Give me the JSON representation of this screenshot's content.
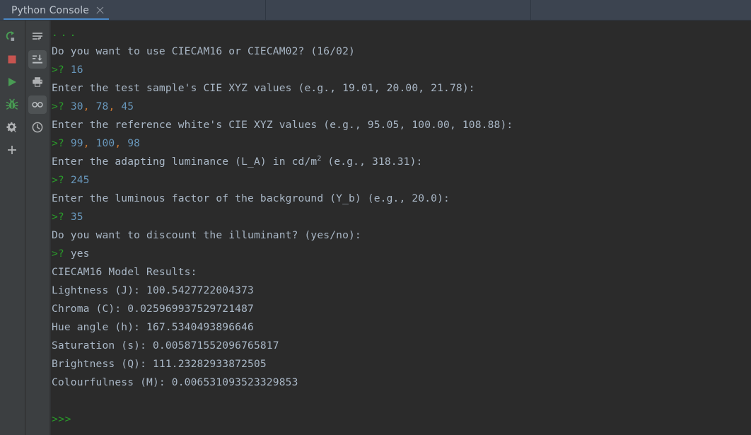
{
  "window": {
    "tab": {
      "label": "Python Console",
      "close_icon": "close-icon"
    },
    "background": "#2b2b2b",
    "header_background": "#3c4450",
    "accent": "#4a88c7"
  },
  "toolbar_left": {
    "buttons": [
      {
        "name": "rerun-button",
        "icon": "rerun-icon",
        "color": "#499c54",
        "active": false
      },
      {
        "name": "stop-button",
        "icon": "stop-square-icon",
        "color": "#c75450",
        "active": false
      },
      {
        "name": "execute-button",
        "icon": "play-triangle-icon",
        "color": "#499c54",
        "active": false
      },
      {
        "name": "debug-button",
        "icon": "bug-icon",
        "color": "#499c54",
        "active": false
      },
      {
        "name": "settings-button",
        "icon": "gear-icon",
        "color": "#afb1b3",
        "active": false
      },
      {
        "name": "add-button",
        "icon": "plus-icon",
        "color": "#afb1b3",
        "active": false
      }
    ]
  },
  "toolbar_right": {
    "buttons": [
      {
        "name": "soft-wrap-button",
        "icon": "soft-wrap-icon",
        "color": "#afb1b3",
        "active": false
      },
      {
        "name": "scroll-to-end-button",
        "icon": "scroll-to-end-icon",
        "color": "#afb1b3",
        "active": true
      },
      {
        "name": "print-button",
        "icon": "printer-icon",
        "color": "#afb1b3",
        "active": false
      },
      {
        "name": "view-mode-button",
        "icon": "glasses-icon",
        "color": "#afb1b3",
        "active": true
      },
      {
        "name": "history-button",
        "icon": "clock-icon",
        "color": "#afb1b3",
        "active": false
      }
    ]
  },
  "console": {
    "lines": [
      {
        "type": "dots",
        "text": "..."
      },
      {
        "type": "output",
        "text": "Do you want to use CIECAM16 or CIECAM02? (16/02)"
      },
      {
        "type": "input",
        "prompt": ">?",
        "value": "16"
      },
      {
        "type": "output",
        "text": "Enter the test sample's CIE XYZ values (e.g., 19.01, 20.00, 21.78):"
      },
      {
        "type": "input-list",
        "prompt": ">?",
        "values": [
          "30",
          "78",
          "45"
        ]
      },
      {
        "type": "output",
        "text": "Enter the reference white's CIE XYZ values (e.g., 95.05, 100.00, 108.88):"
      },
      {
        "type": "input-list",
        "prompt": ">?",
        "values": [
          "99",
          "100",
          "98"
        ]
      },
      {
        "type": "output-sup",
        "pre": "Enter the adapting luminance (L_A) in cd/m",
        "sup": "2",
        "post": " (e.g., 318.31):"
      },
      {
        "type": "input",
        "prompt": ">?",
        "value": "245"
      },
      {
        "type": "output",
        "text": "Enter the luminous factor of the background (Y_b) (e.g., 20.0):"
      },
      {
        "type": "input",
        "prompt": ">?",
        "value": "35"
      },
      {
        "type": "output",
        "text": "Do you want to discount the illuminant? (yes/no):"
      },
      {
        "type": "input-word",
        "prompt": ">?",
        "value": "yes"
      },
      {
        "type": "output",
        "text": "CIECAM16 Model Results:"
      },
      {
        "type": "output",
        "text": "Lightness (J): 100.5427722004373"
      },
      {
        "type": "output",
        "text": "Chroma (C): 0.025969937529721487"
      },
      {
        "type": "output",
        "text": "Hue angle (h): 167.5340493896646"
      },
      {
        "type": "output",
        "text": "Saturation (s): 0.005871552096765817"
      },
      {
        "type": "output",
        "text": "Brightness (Q): 111.23282933872505"
      },
      {
        "type": "output",
        "text": "Colourfulness (M): 0.006531093523329853"
      },
      {
        "type": "blank",
        "text": ""
      },
      {
        "type": "ps1",
        "text": ">>>"
      }
    ]
  }
}
